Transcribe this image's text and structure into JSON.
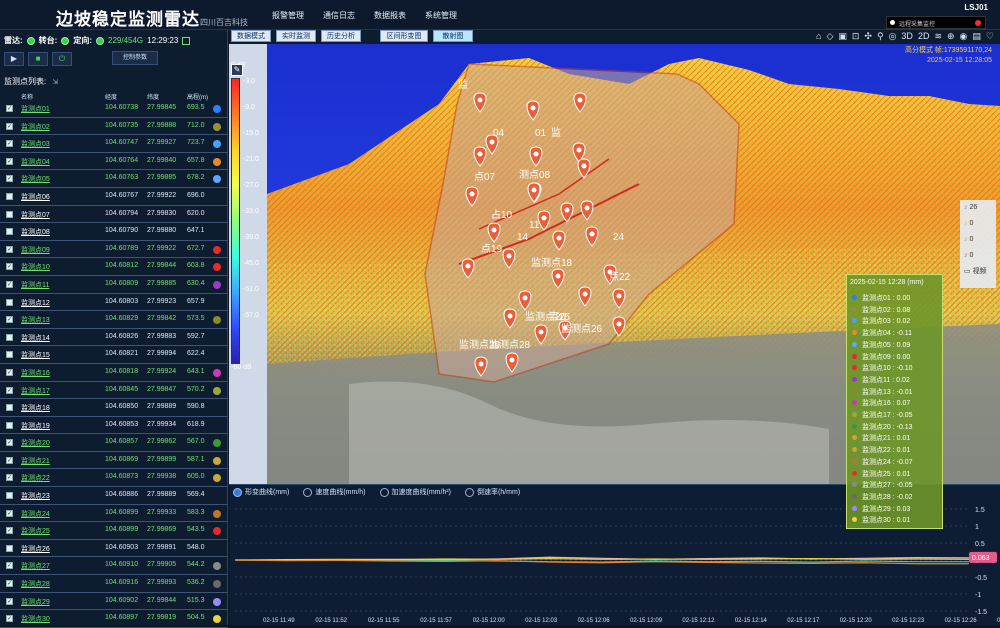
{
  "app": {
    "title": "边坡稳定监测雷达",
    "subtitle": "四川百吉科技",
    "device_id": "LSJ01",
    "alarm_text": "远程采集监控"
  },
  "menu": [
    "报警管理",
    "通信日志",
    "数据报表",
    "系统管理"
  ],
  "status": {
    "radar_label": "雷达:",
    "turntable_label": "转台:",
    "orient_label": "定向:",
    "counter": "229/454G",
    "time": "12:29:23"
  },
  "controls": {
    "param_button": "控制参数"
  },
  "list": {
    "title": "监测点列表:",
    "headers": [
      "名称",
      "经度",
      "纬度",
      "高程(m)"
    ],
    "rows": [
      {
        "name": "监测点01",
        "lng": "104.60738",
        "lat": "27.99845",
        "h": "693.5",
        "color": "#2f7cff",
        "checked": true
      },
      {
        "name": "监测点02",
        "lng": "104.60735",
        "lat": "27.99888",
        "h": "712.0",
        "color": "#9a8f3a",
        "checked": true
      },
      {
        "name": "监测点03",
        "lng": "104.60747",
        "lat": "27.99927",
        "h": "723.7",
        "color": "#45a3ff",
        "checked": true
      },
      {
        "name": "监测点04",
        "lng": "104.60764",
        "lat": "27.99840",
        "h": "657.8",
        "color": "#e58a2a",
        "checked": true
      },
      {
        "name": "监测点05",
        "lng": "104.60763",
        "lat": "27.99885",
        "h": "678.2",
        "color": "#5aa8ff",
        "checked": true
      },
      {
        "name": "监测点06",
        "lng": "104.60767",
        "lat": "27.99922",
        "h": "696.0",
        "color": "",
        "checked": false
      },
      {
        "name": "监测点07",
        "lng": "104.60794",
        "lat": "27.99830",
        "h": "620.0",
        "color": "",
        "checked": false
      },
      {
        "name": "监测点08",
        "lng": "104.60790",
        "lat": "27.99880",
        "h": "647.1",
        "color": "",
        "checked": false
      },
      {
        "name": "监测点09",
        "lng": "104.60789",
        "lat": "27.99922",
        "h": "672.7",
        "color": "#e52a2a",
        "checked": true
      },
      {
        "name": "监测点10",
        "lng": "104.60812",
        "lat": "27.99844",
        "h": "603.8",
        "color": "#e52a2a",
        "checked": true
      },
      {
        "name": "监测点11",
        "lng": "104.60809",
        "lat": "27.99885",
        "h": "630.4",
        "color": "#9a3ac8",
        "checked": true
      },
      {
        "name": "监测点12",
        "lng": "104.60803",
        "lat": "27.99923",
        "h": "657.9",
        "color": "",
        "checked": false
      },
      {
        "name": "监测点13",
        "lng": "104.60829",
        "lat": "27.99842",
        "h": "573.5",
        "color": "#8a8a2a",
        "checked": true
      },
      {
        "name": "监测点14",
        "lng": "104.60826",
        "lat": "27.99883",
        "h": "592.7",
        "color": "",
        "checked": false
      },
      {
        "name": "监测点15",
        "lng": "104.60821",
        "lat": "27.99894",
        "h": "622.4",
        "color": "",
        "checked": false
      },
      {
        "name": "监测点16",
        "lng": "104.60818",
        "lat": "27.99924",
        "h": "643.1",
        "color": "#c83ab8",
        "checked": true
      },
      {
        "name": "监测点17",
        "lng": "104.60845",
        "lat": "27.99847",
        "h": "570.2",
        "color": "#9aa83a",
        "checked": true
      },
      {
        "name": "监测点18",
        "lng": "104.60850",
        "lat": "27.99889",
        "h": "590.8",
        "color": "",
        "checked": false
      },
      {
        "name": "监测点19",
        "lng": "104.60853",
        "lat": "27.99934",
        "h": "618.9",
        "color": "",
        "checked": false
      },
      {
        "name": "监测点20",
        "lng": "104.60857",
        "lat": "27.99862",
        "h": "567.0",
        "color": "#3a9a3a",
        "checked": true
      },
      {
        "name": "监测点21",
        "lng": "104.60869",
        "lat": "27.99899",
        "h": "587.1",
        "color": "#c8a83a",
        "checked": true
      },
      {
        "name": "监测点22",
        "lng": "104.60873",
        "lat": "27.99938",
        "h": "605.0",
        "color": "#c8a83a",
        "checked": true
      },
      {
        "name": "监测点23",
        "lng": "104.60886",
        "lat": "27.99889",
        "h": "569.4",
        "color": "",
        "checked": false
      },
      {
        "name": "监测点24",
        "lng": "104.60899",
        "lat": "27.99933",
        "h": "583.3",
        "color": "#b87a2a",
        "checked": true
      },
      {
        "name": "监测点25",
        "lng": "104.60899",
        "lat": "27.99869",
        "h": "543.5",
        "color": "#e52a2a",
        "checked": true
      },
      {
        "name": "监测点26",
        "lng": "104.60903",
        "lat": "27.99891",
        "h": "548.0",
        "color": "",
        "checked": false
      },
      {
        "name": "监测点27",
        "lng": "104.60910",
        "lat": "27.99905",
        "h": "544.2",
        "color": "#8a8a8a",
        "checked": true
      },
      {
        "name": "监测点28",
        "lng": "104.60916",
        "lat": "27.99893",
        "h": "536.2",
        "color": "#6a6a6a",
        "checked": true
      },
      {
        "name": "监测点29",
        "lng": "104.60902",
        "lat": "27.99844",
        "h": "515.3",
        "color": "#9a8aff",
        "checked": true
      },
      {
        "name": "监测点30",
        "lng": "104.60897",
        "lat": "27.99819",
        "h": "504.5",
        "color": "#f0d23a",
        "checked": true
      }
    ]
  },
  "view_tabs": [
    "数据模式",
    "实时监测",
    "历史分析",
    "区间形变图",
    "散射图"
  ],
  "toolbar_icons": [
    "home-icon",
    "layer-icon",
    "save-icon",
    "lock-icon",
    "node-icon",
    "pin-icon",
    "globe-icon",
    "3d-icon",
    "2d-icon",
    "layers2-icon",
    "target-icon",
    "eye-icon",
    "image-icon",
    "heart-icon"
  ],
  "toolbar_labels": {
    "3d": "3D",
    "2d": "2D"
  },
  "mode_info": {
    "line1": "高分模式 帧:1739591170,24",
    "line2": "2025-02-15 12:28:05"
  },
  "colorbar": {
    "top": "0 dB",
    "bottom": "-60 dB",
    "ticks": [
      "-3.0",
      "-9.0",
      "-15.0",
      "-21.0",
      "-27.0",
      "-33.0",
      "-39.0",
      "-45.0",
      "-51.0",
      "-57.0"
    ]
  },
  "side_panel": [
    {
      "icon": "bell-icon",
      "value": "26",
      "color": "#3a8ae6"
    },
    {
      "icon": "bell-icon",
      "value": "0",
      "color": "#e6c23a"
    },
    {
      "icon": "bell-icon",
      "value": "0",
      "color": "#e68a2a"
    },
    {
      "icon": "bell-icon",
      "value": "0",
      "color": "#e63a3a"
    },
    {
      "icon": "camera-icon",
      "value": "视频",
      "color": "#333"
    }
  ],
  "legend": {
    "title": "2025-02-15 12:28 (mm)",
    "items": [
      {
        "label": "监测点01 : 0.00",
        "color": "#2f7cff"
      },
      {
        "label": "监测点02 : 0.08",
        "color": "#9a8f3a"
      },
      {
        "label": "监测点03 : 0.02",
        "color": "#45a3ff"
      },
      {
        "label": "监测点04 : -0.11",
        "color": "#e58a2a"
      },
      {
        "label": "监测点05 : 0.09",
        "color": "#5aa8ff"
      },
      {
        "label": "监测点09 : 0.00",
        "color": "#e52a2a"
      },
      {
        "label": "监测点10 : -0.10",
        "color": "#e52a2a"
      },
      {
        "label": "监测点11 : 0.02",
        "color": "#9a3ac8"
      },
      {
        "label": "监测点13 : -0.01",
        "color": "#8a8a2a"
      },
      {
        "label": "监测点16 : 0.07",
        "color": "#c83ab8"
      },
      {
        "label": "监测点17 : -0.05",
        "color": "#9aa83a"
      },
      {
        "label": "监测点20 : -0.13",
        "color": "#3a9a3a"
      },
      {
        "label": "监测点21 : 0.01",
        "color": "#c8a83a"
      },
      {
        "label": "监测点22 : 0.01",
        "color": "#c8a83a"
      },
      {
        "label": "监测点24 : -0.07",
        "color": "#b87a2a"
      },
      {
        "label": "监测点25 : 0.01",
        "color": "#e52a2a"
      },
      {
        "label": "监测点27 : -0.05",
        "color": "#8a8a8a"
      },
      {
        "label": "监测点28 : -0.02",
        "color": "#6a6a6a"
      },
      {
        "label": "监测点29 : 0.03",
        "color": "#9a8aff"
      },
      {
        "label": "监测点30 : 0.01",
        "color": "#f0d23a"
      }
    ]
  },
  "chart_tabs": [
    "形变曲线(mm)",
    "速度曲线(mm/h)",
    "加速度曲线(mm/h²)",
    "倒速率(h/mm)"
  ],
  "chart_current_value": "0.063",
  "chart_data": {
    "type": "line",
    "x": [
      "02-15 11:49",
      "02-15 11:52",
      "02-15 11:55",
      "02-15 11:57",
      "02-15 12:00",
      "02-15 12:03",
      "02-15 12:06",
      "02-15 12:09",
      "02-15 12:12",
      "02-15 12:14",
      "02-15 12:17",
      "02-15 12:20",
      "02-15 12:23",
      "02-15 12:26",
      "02-15 12:28"
    ],
    "ylim": [
      -1.5,
      1.5
    ],
    "yticks": [
      "1.5",
      "1",
      "0.5",
      "0",
      "-0.5",
      "-1",
      "-1.5"
    ],
    "series": [
      {
        "values": [
          0,
          0,
          0.01,
          0.02,
          0.01,
          0.03,
          0.08,
          0.05,
          0.02,
          0.04,
          0.06,
          0.03,
          0.05,
          0.07,
          0.063
        ],
        "color": "#e8b0c8"
      },
      {
        "values": [
          0,
          -0.01,
          0,
          -0.02,
          -0.01,
          -0.03,
          -0.05,
          -0.06,
          -0.03,
          -0.05,
          -0.04,
          -0.06,
          -0.03,
          -0.05,
          -0.05
        ],
        "color": "#3ad0a8"
      },
      {
        "values": [
          0,
          0.01,
          0.02,
          0.01,
          0.03,
          0.02,
          0.04,
          0.02,
          0.03,
          0.02,
          0.03,
          0.04,
          0.02,
          0.03,
          0.02
        ],
        "color": "#f0d23a"
      },
      {
        "values": [
          0,
          -0.02,
          -0.01,
          -0.03,
          -0.04,
          -0.02,
          -0.06,
          -0.08,
          -0.05,
          -0.07,
          -0.09,
          -0.1,
          -0.08,
          -0.11,
          -0.11
        ],
        "color": "#e58a2a"
      }
    ]
  },
  "map_labels": [
    "监",
    "04",
    "01",
    "监",
    "点07",
    "测点08",
    "占10",
    "11",
    "14",
    "点19",
    "监测点18",
    "监测点20",
    "点22",
    "点25",
    "监测点26",
    "监测点29",
    "监测点28",
    "24"
  ],
  "marker_count": 30
}
